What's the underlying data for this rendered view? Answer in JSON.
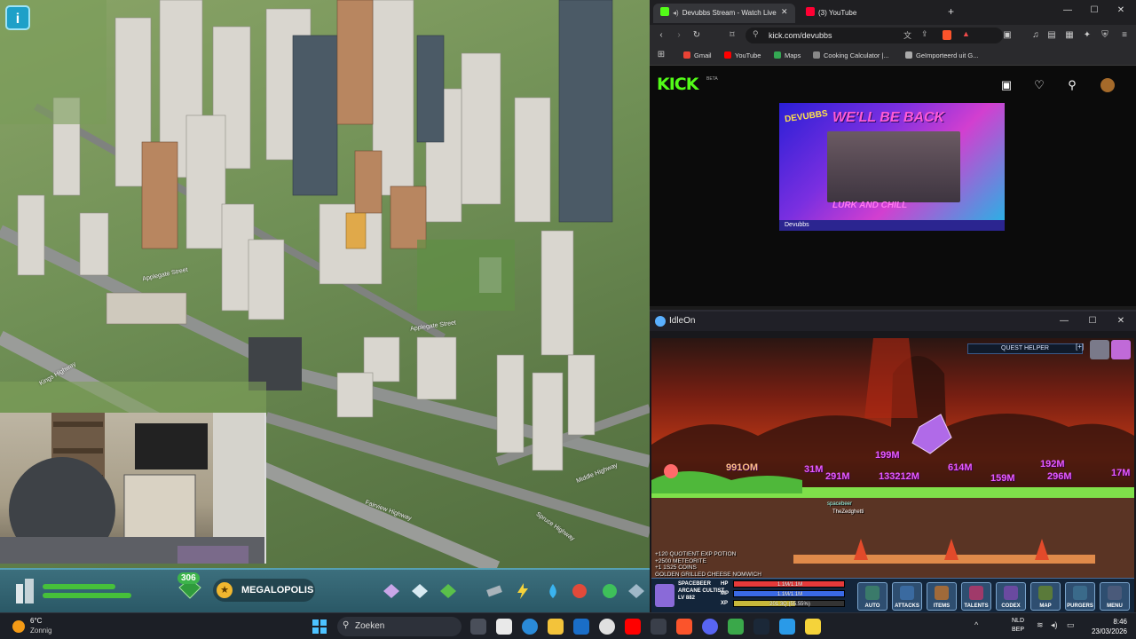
{
  "city_game": {
    "road_labels": [
      "Applegate Street",
      "Kings Highway",
      "Fairview Highway",
      "Middle Highway",
      "Spruce Highway",
      "Applegate Street"
    ],
    "milestone_count": "306",
    "milestone_name": "MEGALOPOLIS",
    "info_icon": "i"
  },
  "browser": {
    "tabs": [
      {
        "label": "Devubbs Stream - Watch Live",
        "active": true,
        "icon": "kick-icon"
      },
      {
        "label": "(3) YouTube",
        "active": false,
        "icon": "youtube-icon"
      }
    ],
    "new_tab": "+",
    "url": "kick.com/devubbs",
    "bookmarks": [
      {
        "label": "Gmail",
        "color": "#ea4335"
      },
      {
        "label": "YouTube",
        "color": "#ff0000"
      },
      {
        "label": "Maps",
        "color": "#34a853"
      },
      {
        "label": "Cooking Calculator |...",
        "color": "#888888"
      },
      {
        "label": "Geïmporteerd uit G...",
        "color": "#aaaaaa"
      }
    ],
    "kick": {
      "logo": "KICK",
      "beta": "BETA",
      "offline_banner": {
        "title": "WE'LL BE BACK",
        "brand": "DEVUBBS",
        "subtitle": "LURK AND CHILL",
        "footer": "Devubbs"
      }
    }
  },
  "idleon": {
    "window_title": "IdleOn",
    "quest_helper": "QUEST HELPER",
    "damage_numbers": [
      "991OM",
      "31M",
      "291M",
      "199M",
      "133212M",
      "614M",
      "159M",
      "192M",
      "296M",
      "17M"
    ],
    "player_names": [
      "spacebeer",
      "TheZedghetti"
    ],
    "log_lines": [
      "+120 QUOTIENT EXP POTION",
      "+2500 METEORITE",
      "+1 1S25 COINS",
      "GOLDEN GRILLED CHEESE NOMWICH"
    ],
    "character": {
      "name": "SPACEBEER",
      "class": "ARCANE CULTIST",
      "level": "LV 882"
    },
    "stats": [
      {
        "key": "HP",
        "value": "1.1M/1.1M",
        "fraction": 1.0,
        "color": "#e63a3a"
      },
      {
        "key": "MP",
        "value": "1.1M/1.1M",
        "fraction": 1.0,
        "color": "#3a6ae6"
      },
      {
        "key": "XP",
        "value": "201.3Q (55.55%)",
        "fraction": 0.5555,
        "color": "#c8b83a"
      }
    ],
    "buttons": [
      "AUTO",
      "ATTACKS",
      "ITEMS",
      "TALENTS",
      "CODEX",
      "MAP",
      "PURGERS",
      "MENU"
    ]
  },
  "taskbar": {
    "weather_temp": "6°C",
    "weather_desc": "Zonnig",
    "search_placeholder": "Zoeken",
    "lang_line1": "NLD",
    "lang_line2": "BEP",
    "time": "8:46",
    "date": "23/03/2026"
  }
}
